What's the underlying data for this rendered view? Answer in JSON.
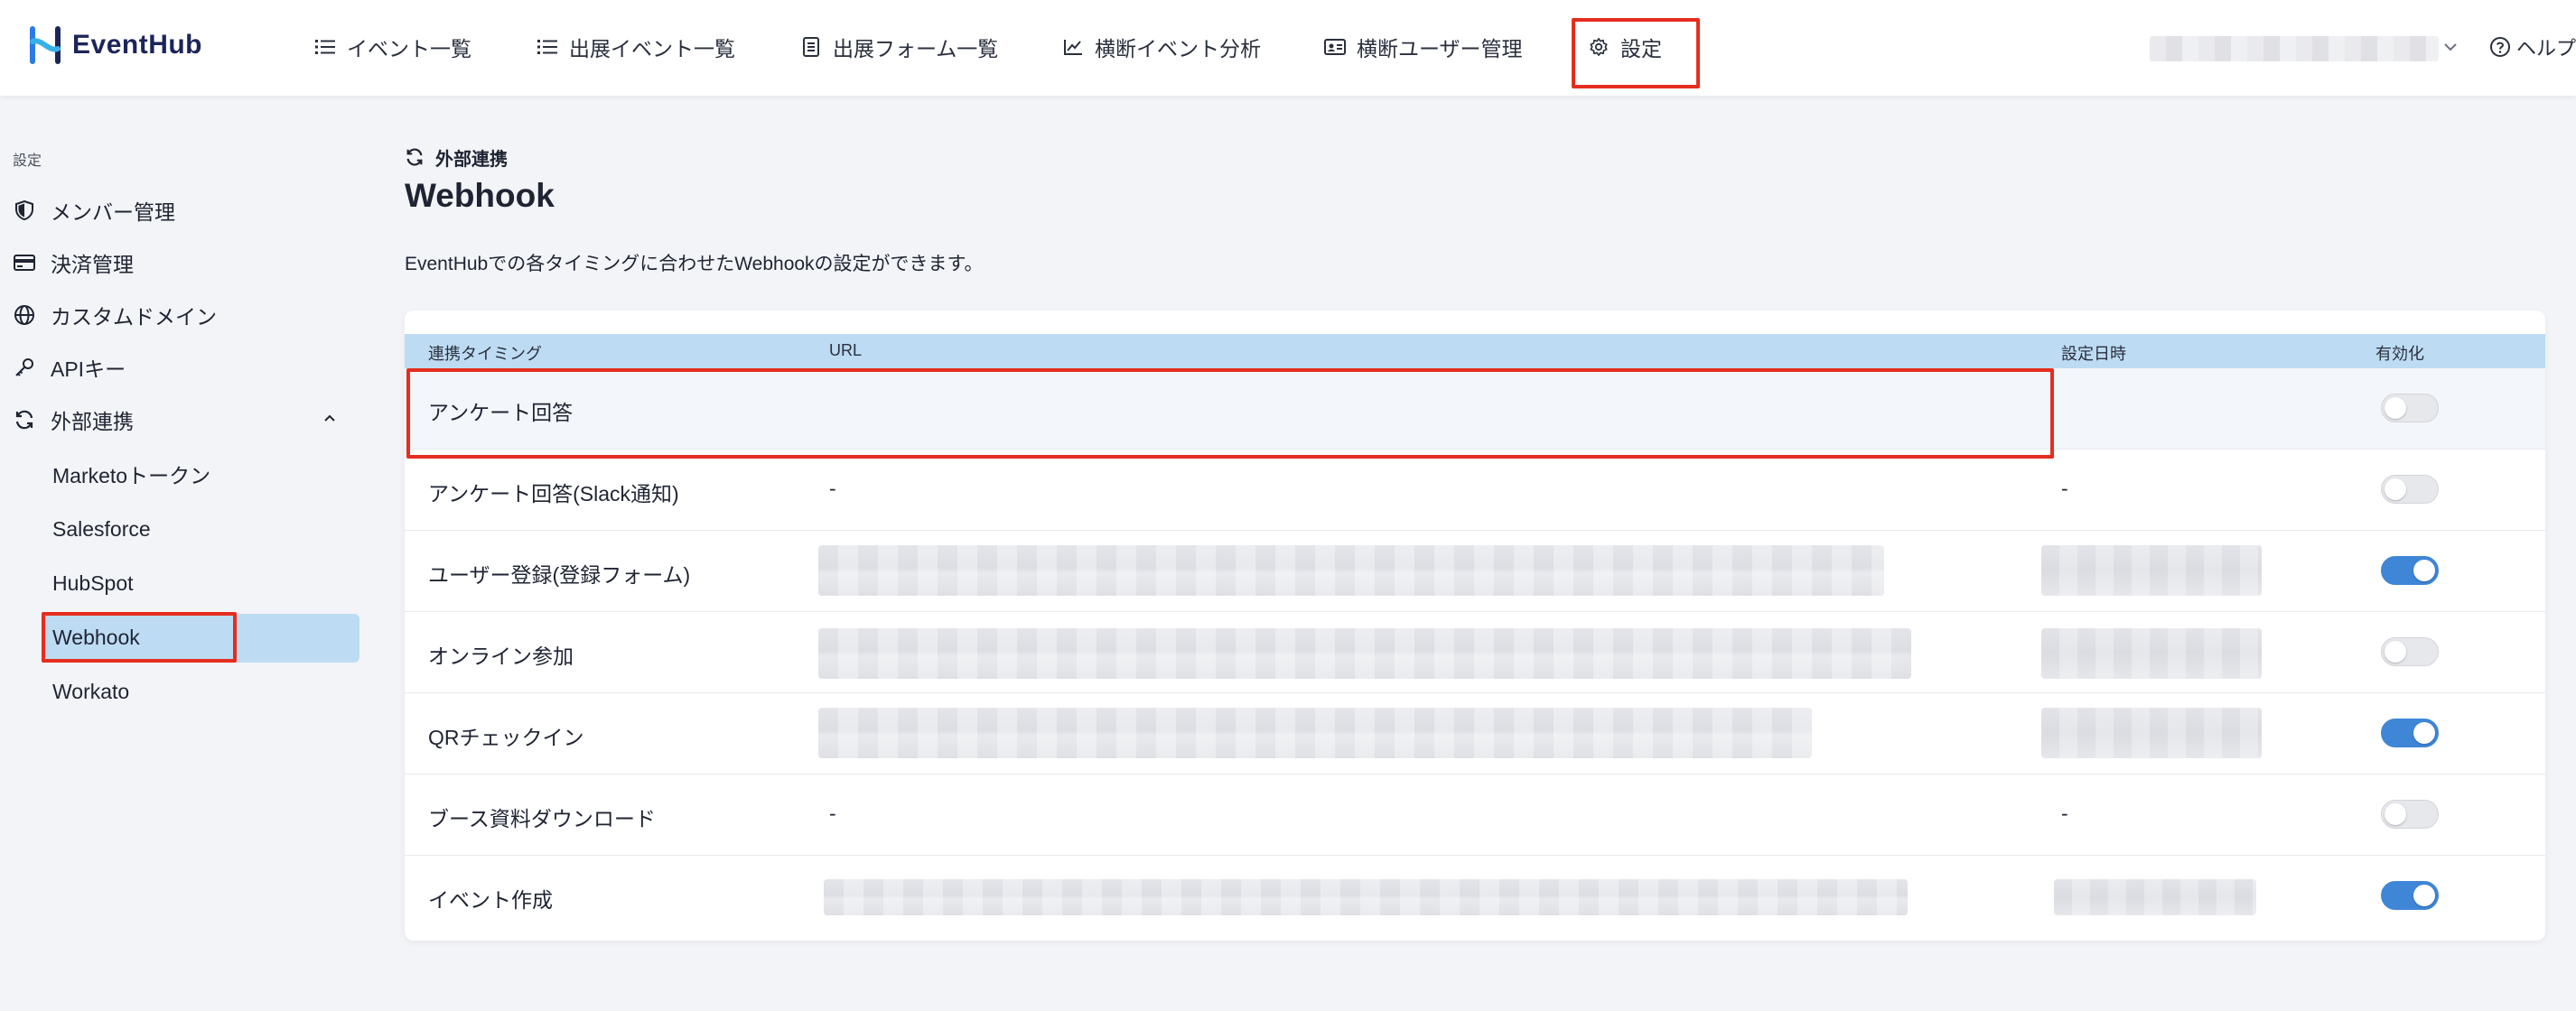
{
  "header": {
    "logo_text": "EventHub",
    "nav": [
      {
        "label": "イベント一覧",
        "icon": "list-icon"
      },
      {
        "label": "出展イベント一覧",
        "icon": "list-icon"
      },
      {
        "label": "出展フォーム一覧",
        "icon": "form-icon"
      },
      {
        "label": "横断イベント分析",
        "icon": "chart-line-icon"
      },
      {
        "label": "横断ユーザー管理",
        "icon": "id-card-icon"
      },
      {
        "label": "設定",
        "icon": "gear-icon"
      }
    ],
    "help_label": "ヘルプ"
  },
  "sidebar": {
    "section_label": "設定",
    "items": [
      {
        "label": "メンバー管理",
        "icon": "shield-icon"
      },
      {
        "label": "決済管理",
        "icon": "credit-card-icon"
      },
      {
        "label": "カスタムドメイン",
        "icon": "globe-icon"
      },
      {
        "label": "APIキー",
        "icon": "key-icon"
      },
      {
        "label": "外部連携",
        "icon": "sync-icon"
      }
    ],
    "sub_items": [
      {
        "label": "Marketoトークン"
      },
      {
        "label": "Salesforce"
      },
      {
        "label": "HubSpot"
      },
      {
        "label": "Webhook",
        "active": true
      },
      {
        "label": "Workato"
      }
    ]
  },
  "main": {
    "breadcrumb": "外部連携",
    "title": "Webhook",
    "description": "EventHubでの各タイミングに合わせたWebhookの設定ができます。",
    "table": {
      "columns": [
        "連携タイミング",
        "URL",
        "設定日時",
        "有効化"
      ],
      "rows": [
        {
          "timing": "アンケート回答",
          "url": "",
          "date": "",
          "enabled": false
        },
        {
          "timing": "アンケート回答(Slack通知)",
          "url": "-",
          "date": "-",
          "enabled": false
        },
        {
          "timing": "ユーザー登録(登録フォーム)",
          "url": "",
          "date": "",
          "enabled": true
        },
        {
          "timing": "オンライン参加",
          "url": "",
          "date": "",
          "enabled": false
        },
        {
          "timing": "QRチェックイン",
          "url": "",
          "date": "",
          "enabled": true
        },
        {
          "timing": "ブース資料ダウンロード",
          "url": "-",
          "date": "-",
          "enabled": false
        },
        {
          "timing": "イベント作成",
          "url": "",
          "date": "",
          "enabled": true
        }
      ]
    }
  },
  "colors": {
    "accent": "#3f86d6",
    "highlight": "#e52d1f",
    "header_row": "#bddcf3",
    "brand": "#1c2559"
  }
}
